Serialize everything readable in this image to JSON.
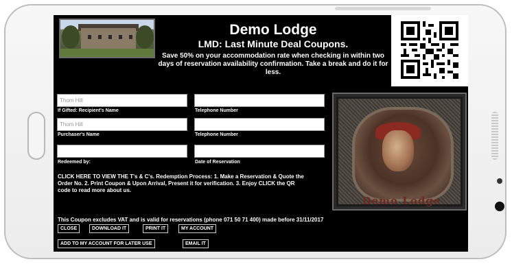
{
  "coupon": {
    "title": "Demo Lodge",
    "subtitle": "LMD: Last Minute Deal Coupons.",
    "blurb": "Save 50% on your accommodation rate when checking in within two days of reservation availability confirmation. Take a break and do it for less."
  },
  "form": {
    "recipient_name": {
      "value": "Thom Hill",
      "label": "If Gifted: Recipient's Name"
    },
    "recipient_phone": {
      "value": "",
      "label": "Telephone Number"
    },
    "purchaser_name": {
      "value": "Thom Hill",
      "label": "Purchaser's Name"
    },
    "purchaser_phone": {
      "value": "",
      "label": "Telephone Number"
    },
    "redeemed_by": {
      "value": "",
      "label": "Redeemed by:"
    },
    "reservation_date": {
      "value": "",
      "label": "Date of Reservation"
    }
  },
  "artwork": {
    "label": "Demo Lodge"
  },
  "process_text": "CLICK HERE TO VIEW THE T's & C's. Redemption Process: 1. Make a Reservation & Quote the Order No. 2. Print Coupon & Upon Arrival, Present it for verification. 3. Enjoy CLICK the QR code to read more about us.",
  "notice": "This Coupon excludes VAT and is valid for reservations (phone 071 50 71 400) made before 31/11/2017",
  "buttons": {
    "close": "CLOSE",
    "download": "DOWNLOAD IT",
    "print": "PRINT IT",
    "my_account": "MY ACCOUNT",
    "add_to_account": "ADD TO MY ACCOUNT FOR LATER USE",
    "email": "EMAIL IT"
  },
  "icons": {
    "qr": "qr-code-icon",
    "photo": "lodge-photo"
  },
  "colors": {
    "screen": "#000000",
    "art_label": "#6e2a1e"
  }
}
